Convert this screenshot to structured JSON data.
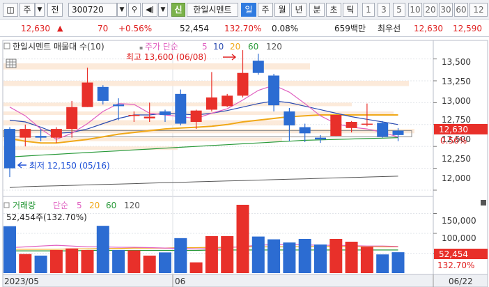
{
  "toolbar": {
    "layout_btn": "◫",
    "mode": "주",
    "prev": "전",
    "code": "300720",
    "new_badge": "신",
    "name": "한일시멘트",
    "period_day": "일",
    "period_week": "주",
    "period_month": "월",
    "period_year": "년",
    "period_min": "분",
    "period_sec": "초",
    "period_tick": "틱",
    "intervals": [
      "1",
      "3",
      "5",
      "10",
      "20",
      "30",
      "60",
      "12"
    ]
  },
  "quote": {
    "price": "12,630",
    "change": "70",
    "change_pct": "+0.56%",
    "volume": "52,454",
    "vol_ratio": "132.70%",
    "turnover_rate": "0.08%",
    "amount": "659백만",
    "best_label": "최우선",
    "ask": "12,630",
    "bid": "12,590"
  },
  "price_panel": {
    "legend_name": "한일시멘트 매물대 수(10)",
    "legend_ma_label": "주가 단순",
    "legend_ma5": "5",
    "legend_ma10": "10",
    "legend_ma20": "20",
    "legend_ma60": "60",
    "legend_ma120": "120",
    "high_note": "최고 13,600 (06/08)",
    "low_note": "최저 12,150 (05/16)",
    "current_label": "12,630",
    "current_pct": "0.56%",
    "y_ticks": [
      "13,500",
      "13,250",
      "13,000",
      "12,750",
      "12,500",
      "12,250",
      "12,000"
    ]
  },
  "volume_panel": {
    "legend_name": "거래량",
    "legend_ma_label": "단순",
    "legend_ma5": "5",
    "legend_ma20": "20",
    "legend_ma60": "60",
    "legend_ma120": "120",
    "info": "52,454주(132.70%)",
    "current_label": "52,454",
    "current_pct": "132.70%",
    "y_ticks": [
      "150,000",
      "100,000",
      "50,000"
    ]
  },
  "xaxis": {
    "labels": [
      "2023/05",
      "06"
    ],
    "right_label": "06/22"
  },
  "colors": {
    "up": "#e8302a",
    "down": "#2c6cd2",
    "ma5": "#e060c0",
    "ma10": "#2a4ab0",
    "ma20": "#f0a818",
    "ma60": "#2a9a3a",
    "ma120": "#555555"
  },
  "chart_data": {
    "type": "candlestick",
    "dates": [
      "05/16",
      "05/17",
      "05/18",
      "05/19",
      "05/22",
      "05/23",
      "05/24",
      "05/25",
      "05/26",
      "05/30",
      "05/31",
      "06/01",
      "06/02",
      "06/05",
      "06/07",
      "06/08",
      "06/09",
      "06/12",
      "06/13",
      "06/14",
      "06/15",
      "06/16",
      "06/19",
      "06/20",
      "06/21",
      "06/22"
    ],
    "candles": [
      {
        "o": 12700,
        "h": 12720,
        "l": 12150,
        "c": 12250
      },
      {
        "o": 12600,
        "h": 12750,
        "l": 12500,
        "c": 12700
      },
      {
        "o": 12620,
        "h": 12700,
        "l": 12560,
        "c": 12600
      },
      {
        "o": 12600,
        "h": 12720,
        "l": 12540,
        "c": 12700
      },
      {
        "o": 12700,
        "h": 13020,
        "l": 12600,
        "c": 12950
      },
      {
        "o": 12950,
        "h": 13400,
        "l": 12950,
        "c": 13230
      },
      {
        "o": 13180,
        "h": 13200,
        "l": 12980,
        "c": 13020
      },
      {
        "o": 12980,
        "h": 13050,
        "l": 12800,
        "c": 12960
      },
      {
        "o": 12860,
        "h": 12900,
        "l": 12780,
        "c": 12860
      },
      {
        "o": 12820,
        "h": 13000,
        "l": 12780,
        "c": 12840
      },
      {
        "o": 12900,
        "h": 12920,
        "l": 12780,
        "c": 12860
      },
      {
        "o": 13100,
        "h": 13150,
        "l": 12740,
        "c": 12760
      },
      {
        "o": 12780,
        "h": 12920,
        "l": 12700,
        "c": 12910
      },
      {
        "o": 12920,
        "h": 13350,
        "l": 12900,
        "c": 13060
      },
      {
        "o": 12960,
        "h": 13100,
        "l": 12950,
        "c": 13080
      },
      {
        "o": 13080,
        "h": 13600,
        "l": 13060,
        "c": 13340
      },
      {
        "o": 13480,
        "h": 13560,
        "l": 13320,
        "c": 13340
      },
      {
        "o": 13310,
        "h": 13330,
        "l": 12900,
        "c": 12970
      },
      {
        "o": 12900,
        "h": 12940,
        "l": 12560,
        "c": 12740
      },
      {
        "o": 12720,
        "h": 12760,
        "l": 12550,
        "c": 12650
      },
      {
        "o": 12600,
        "h": 12630,
        "l": 12540,
        "c": 12580
      },
      {
        "o": 12620,
        "h": 12860,
        "l": 12620,
        "c": 12860
      },
      {
        "o": 12710,
        "h": 12790,
        "l": 12660,
        "c": 12780
      },
      {
        "o": 12750,
        "h": 12990,
        "l": 12730,
        "c": 12760
      },
      {
        "o": 12770,
        "h": 12790,
        "l": 12600,
        "c": 12610
      },
      {
        "o": 12680,
        "h": 12710,
        "l": 12560,
        "c": 12630
      }
    ],
    "volume": [
      118000,
      48000,
      44000,
      58000,
      62000,
      58000,
      119000,
      58000,
      57000,
      44000,
      52000,
      88000,
      27000,
      93000,
      93000,
      172000,
      92000,
      85000,
      77000,
      86000,
      72000,
      86000,
      79000,
      66000,
      47000,
      52454
    ],
    "ma5": [
      12950,
      12850,
      12700,
      12580,
      12650,
      12760,
      12900,
      12990,
      12980,
      12880,
      12860,
      12840,
      12820,
      12880,
      12930,
      13030,
      13140,
      13200,
      13120,
      12990,
      12850,
      12760,
      12720,
      12700,
      12660,
      12610
    ],
    "ma10": [
      12800,
      12780,
      12720,
      12650,
      12660,
      12700,
      12760,
      12820,
      12860,
      12860,
      12880,
      12870,
      12860,
      12880,
      12910,
      12950,
      12990,
      13020,
      13000,
      12960,
      12920,
      12880,
      12840,
      12810,
      12780,
      12750
    ],
    "ma20": [
      12590,
      12560,
      12540,
      12540,
      12560,
      12580,
      12610,
      12640,
      12660,
      12680,
      12700,
      12710,
      12720,
      12730,
      12750,
      12780,
      12800,
      12820,
      12840,
      12850,
      12860,
      12860,
      12860,
      12860,
      12860,
      12860
    ],
    "ma60": [
      12380,
      12390,
      12400,
      12410,
      12420,
      12430,
      12440,
      12450,
      12460,
      12470,
      12480,
      12490,
      12500,
      12510,
      12520,
      12530,
      12540,
      12550,
      12560,
      12570,
      12575,
      12580,
      12585,
      12590,
      12595,
      12600
    ],
    "ma120": [
      12030,
      12040,
      12045,
      12050,
      12055,
      12060,
      12065,
      12070,
      12075,
      12080,
      12085,
      12090,
      12095,
      12100,
      12105,
      12110,
      12115,
      12120,
      12125,
      12130,
      12135,
      12140,
      12145,
      12150,
      12155,
      12160
    ],
    "vma5": [
      64000,
      66000,
      68000,
      70000,
      68000,
      66000,
      66000,
      65000,
      65000,
      64000,
      63000,
      62000,
      61000,
      62000,
      64000,
      67000,
      70000,
      72000,
      72000,
      71000,
      70000,
      70000,
      69000,
      68000,
      68000,
      67000
    ],
    "vma20": [
      60000,
      60000,
      60000,
      60000,
      61000,
      61000,
      62000,
      62000,
      63000,
      63000,
      63000,
      64000,
      64000,
      65000,
      65000,
      66000,
      66000,
      66000,
      66000,
      67000,
      67000,
      67000,
      67000,
      67000,
      66000,
      66000
    ],
    "vma60": [
      56000,
      56000,
      56000,
      56000,
      56000,
      57000,
      57000,
      57000,
      57000,
      57000,
      57000,
      57000,
      57000,
      58000,
      58000,
      58000,
      58000,
      58000,
      58000,
      58000,
      58000,
      58000,
      58000,
      58000,
      58000,
      58000
    ],
    "price_ylim": [
      11960,
      13680
    ],
    "volume_ylim": [
      0,
      186000
    ],
    "grid": true,
    "legend_placement": "top-left"
  }
}
